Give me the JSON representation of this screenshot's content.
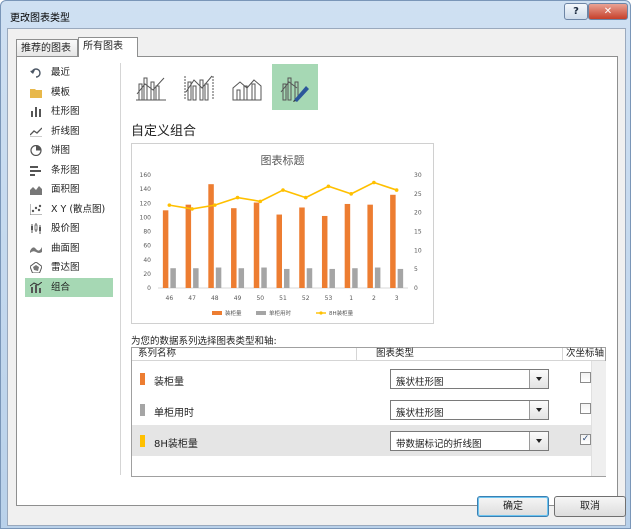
{
  "dialog": {
    "title": "更改图表类型",
    "help_label": "?",
    "close_label": "✕",
    "tabs": [
      {
        "label": "推荐的图表",
        "selected": false
      },
      {
        "label": "所有图表",
        "selected": true
      }
    ]
  },
  "sidebar": {
    "items": [
      {
        "label": "最近",
        "icon": "recent-icon"
      },
      {
        "label": "模板",
        "icon": "folder-icon"
      },
      {
        "label": "柱形图",
        "icon": "column-chart-icon"
      },
      {
        "label": "折线图",
        "icon": "line-chart-icon"
      },
      {
        "label": "饼图",
        "icon": "pie-chart-icon"
      },
      {
        "label": "条形图",
        "icon": "bar-chart-icon"
      },
      {
        "label": "面积图",
        "icon": "area-chart-icon"
      },
      {
        "label": "X Y (散点图)",
        "icon": "scatter-chart-icon"
      },
      {
        "label": "股价图",
        "icon": "stock-chart-icon"
      },
      {
        "label": "曲面图",
        "icon": "surface-chart-icon"
      },
      {
        "label": "雷达图",
        "icon": "radar-chart-icon"
      },
      {
        "label": "组合",
        "icon": "combo-chart-icon",
        "selected": true
      }
    ]
  },
  "combo_types": {
    "icons": [
      "clustered-column-line-icon",
      "clustered-column-line-secondary-icon",
      "stacked-area-column-icon",
      "custom-combination-icon"
    ],
    "selected_index": 3
  },
  "section": {
    "title": "自定义组合"
  },
  "chart_data": {
    "type": "bar",
    "title": "图表标题",
    "categories": [
      "46",
      "47",
      "48",
      "49",
      "50",
      "51",
      "52",
      "53",
      "1",
      "2",
      "3"
    ],
    "series": [
      {
        "name": "装柜量",
        "type": "bar",
        "axis": "primary",
        "color": "#ed7d31",
        "values": [
          110,
          118,
          147,
          113,
          121,
          104,
          114,
          102,
          119,
          118,
          132
        ]
      },
      {
        "name": "单柜用时",
        "type": "bar",
        "axis": "primary",
        "color": "#a5a5a5",
        "values": [
          28,
          28,
          29,
          28,
          29,
          27,
          28,
          27,
          28,
          29,
          27
        ]
      },
      {
        "name": "8H装柜量",
        "type": "line",
        "axis": "secondary",
        "color": "#ffc000",
        "values": [
          22,
          21,
          22,
          24,
          23,
          26,
          24,
          27,
          25,
          28,
          26
        ]
      }
    ],
    "y_ticks": [
      "160",
      "140",
      "120",
      "100",
      "80",
      "60",
      "40",
      "20",
      "0"
    ],
    "y2_ticks": [
      "30",
      "25",
      "20",
      "15",
      "10",
      "5",
      "0"
    ],
    "ylim": [
      0,
      160
    ],
    "y2lim": [
      0,
      30
    ],
    "legend": [
      {
        "name": "装柜量",
        "marker": "bar"
      },
      {
        "name": "单柜用时",
        "marker": "bar"
      },
      {
        "name": "8H装柜量",
        "marker": "line"
      }
    ],
    "legend_position": "bottom",
    "grid": false
  },
  "series_assignment": {
    "label": "为您的数据系列选择图表类型和轴:",
    "headers": {
      "name": "系列名称",
      "type": "图表类型",
      "secondary": "次坐标轴"
    },
    "rows": [
      {
        "name": "装柜量",
        "color": "#ed7d31",
        "chart_type": "簇状柱形图",
        "secondary_axis": false
      },
      {
        "name": "单柜用时",
        "color": "#a5a5a5",
        "chart_type": "簇状柱形图",
        "secondary_axis": false
      },
      {
        "name": "8H装柜量",
        "color": "#ffc000",
        "chart_type": "带数据标记的折线图",
        "secondary_axis": true
      }
    ]
  },
  "footer": {
    "ok_label": "确定",
    "cancel_label": "取消"
  }
}
